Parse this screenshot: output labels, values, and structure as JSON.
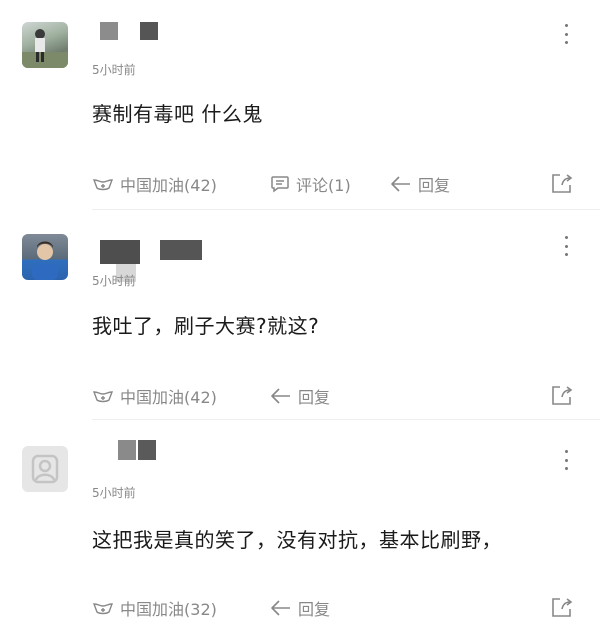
{
  "comments": [
    {
      "time": "5小时前",
      "text": "赛制有毒吧 什么鬼",
      "cheer_label": "中国加油",
      "cheer_count": "(42)",
      "comment_label": "评论",
      "comment_count": "(1)",
      "reply_label": "回复"
    },
    {
      "time": "5小时前",
      "text": "我吐了，刷子大赛?就这?",
      "cheer_label": "中国加油",
      "cheer_count": "(42)",
      "reply_label": "回复"
    },
    {
      "time": "5小时前",
      "text": "这把我是真的笑了，没有对抗，基本比刷野，",
      "cheer_label": "中国加油",
      "cheer_count": "(32)",
      "reply_label": "回复"
    }
  ],
  "icons": {
    "cheer": "cheer-hands-icon",
    "comment": "comment-bubble-icon",
    "reply": "reply-arrow-icon",
    "share": "share-icon",
    "more": "more-vertical-icon"
  },
  "colors": {
    "text_primary": "#1a1a1a",
    "text_secondary": "#888888",
    "divider": "#eeeeee"
  }
}
